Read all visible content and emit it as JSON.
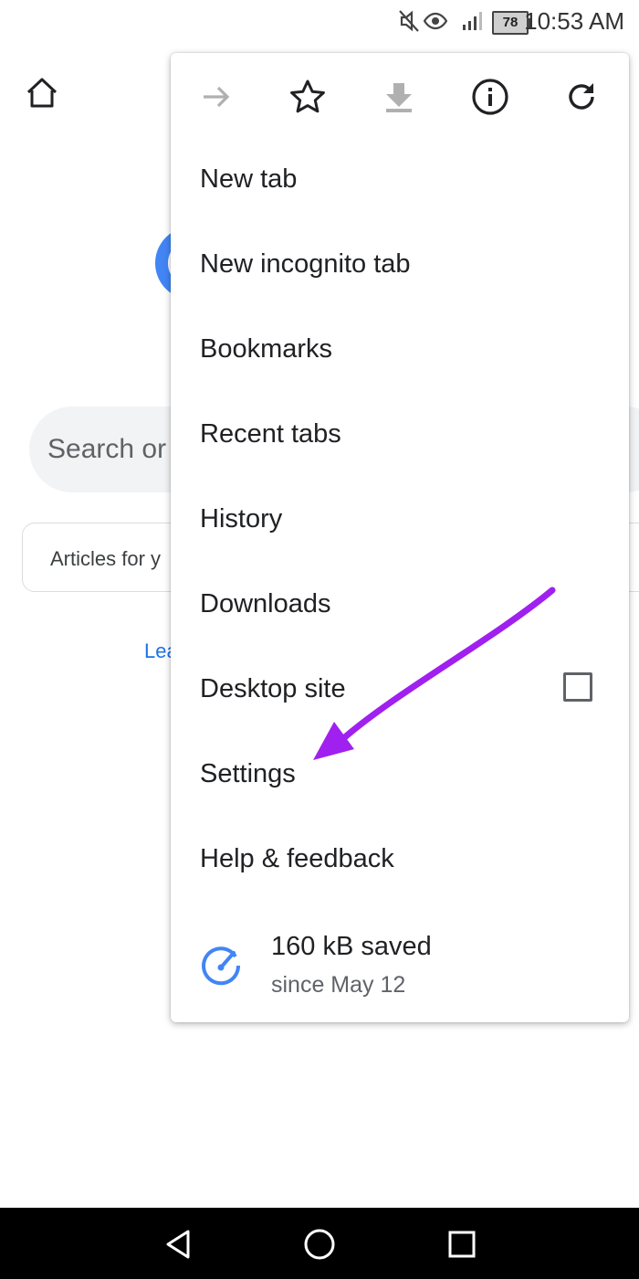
{
  "status_bar": {
    "battery": "78",
    "time": "10:53 AM",
    "icons": [
      "mute-icon",
      "eye-icon",
      "signal-icon",
      "battery-icon"
    ]
  },
  "background_page": {
    "search_placeholder": "Search or",
    "articles_text": "Articles for y",
    "learn_link": "Lea"
  },
  "menu": {
    "toolbar": [
      "forward-icon",
      "star-icon",
      "download-icon",
      "info-icon",
      "reload-icon"
    ],
    "items": [
      {
        "label": "New tab"
      },
      {
        "label": "New incognito tab"
      },
      {
        "label": "Bookmarks"
      },
      {
        "label": "Recent tabs"
      },
      {
        "label": "History"
      },
      {
        "label": "Downloads"
      },
      {
        "label": "Desktop site",
        "checked": false
      },
      {
        "label": "Settings"
      },
      {
        "label": "Help & feedback"
      }
    ],
    "savings": {
      "amount": "160 kB saved",
      "since": "since May 12"
    }
  },
  "annotation": {
    "arrow_color": "#a020f0",
    "points_to": "Settings"
  },
  "colors": {
    "accent_blue": "#4285f4",
    "link_blue": "#1a73e8",
    "nav_bar": "#000000"
  }
}
